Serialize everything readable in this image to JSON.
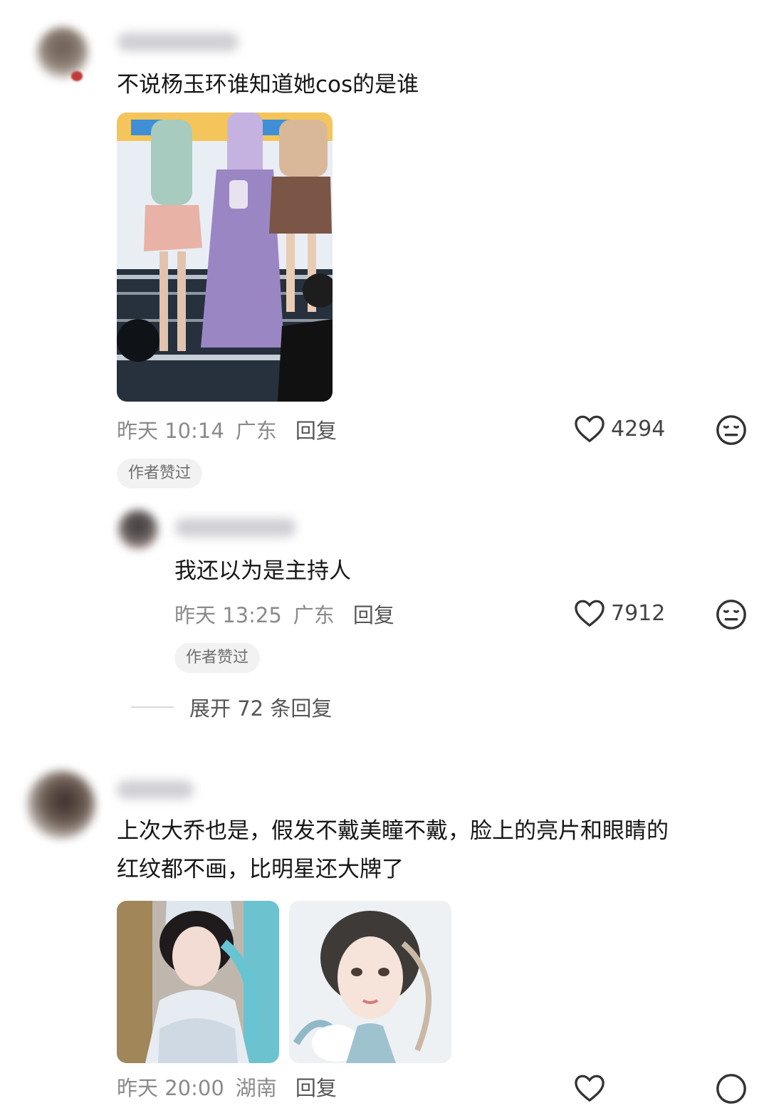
{
  "comments": [
    {
      "text": "不说杨玉环谁知道她cos的是谁",
      "time": "昨天 10:14",
      "location": "广东",
      "reply_label": "回复",
      "likes": "4294",
      "badge": "作者赞过"
    },
    {
      "text": "我还以为是主持人",
      "time": "昨天 13:25",
      "location": "广东",
      "reply_label": "回复",
      "likes": "7912",
      "badge": "作者赞过"
    },
    {
      "text_line1": "上次大乔也是，假发不戴美瞳不戴，脸上的亮片和眼睛的",
      "text_line2": "红纹都不画，比明星还大牌了",
      "time": "昨天 20:00",
      "location": "湖南",
      "reply_label": "回复"
    }
  ],
  "expand_replies": "展开 72 条回复",
  "icons": {
    "like": "heart-outline-icon",
    "dislike": "meh-face-icon"
  },
  "colors": {
    "text": "#161616",
    "meta": "#8a8a8a",
    "badge_bg": "#f2f2f2"
  }
}
